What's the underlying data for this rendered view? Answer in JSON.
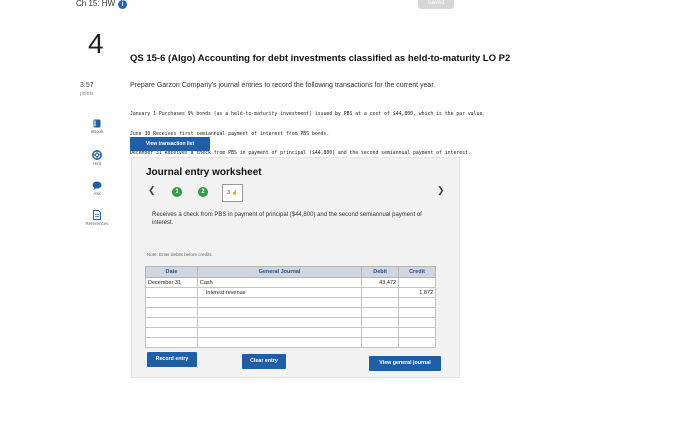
{
  "header": {
    "title": "Ch 15: HW",
    "info_icon": "info-icon",
    "saved_label": "Saved"
  },
  "question": {
    "number": "4",
    "points_value": "3.57",
    "points_label": "points",
    "title": "QS 15-6 (Algo) Accounting for debt investments classified as held-to-maturity LO P2",
    "instructions": "Prepare Garzon Company's journal entries to record the following transactions for the current year.",
    "transactions": [
      "January 1 Purchases 9% bonds (as a held-to-maturity investment) issued by PBS at a cost of $44,800, which is the par value.",
      "June 30 Receives first semiannual payment of interest from PBS bonds.",
      "December 31 Receives a check from PBS in payment of principal ($44,800) and the second semiannual payment of interest."
    ]
  },
  "rail": {
    "ebook": "eBook",
    "hint": "Hint",
    "ask": "Ask",
    "references": "References"
  },
  "buttons": {
    "view_transaction_list": "View transaction list",
    "record_entry": "Record entry",
    "clear_entry": "Clear entry",
    "view_general_journal": "View general journal"
  },
  "worksheet": {
    "title": "Journal entry worksheet",
    "steps": [
      "1",
      "2",
      "3"
    ],
    "description": "Receives a check from PBS in payment of principal ($44,800) and the second semiannual payment of interest.",
    "note": "Note: Enter debits before credits.",
    "columns": [
      "Date",
      "General Journal",
      "Debit",
      "Credit"
    ],
    "rows": [
      {
        "date": "December 31",
        "account": "Cash",
        "debit": "43,472",
        "credit": ""
      },
      {
        "date": "",
        "account": "Interest revenue",
        "debit": "",
        "credit": "1,872"
      },
      {
        "date": "",
        "account": "",
        "debit": "",
        "credit": ""
      },
      {
        "date": "",
        "account": "",
        "debit": "",
        "credit": ""
      },
      {
        "date": "",
        "account": "",
        "debit": "",
        "credit": ""
      },
      {
        "date": "",
        "account": "",
        "debit": "",
        "credit": ""
      },
      {
        "date": "",
        "account": "",
        "debit": "",
        "credit": ""
      }
    ]
  },
  "colors": {
    "accent": "#1f5fa8",
    "step_complete": "#2f9e44",
    "table_header": "#cfd6e0"
  }
}
